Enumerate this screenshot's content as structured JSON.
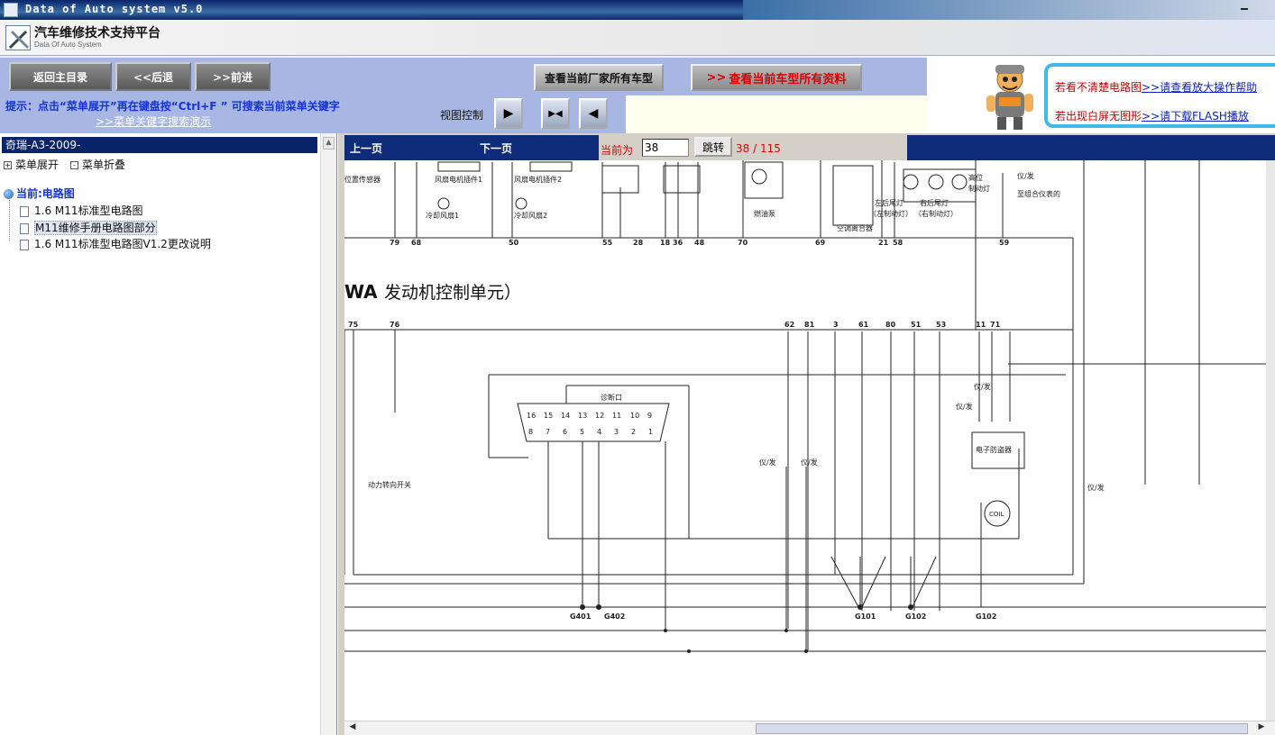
{
  "window": {
    "title": "Data of Auto system v5.0"
  },
  "header": {
    "title": "汽车维修技术支持平台",
    "subtitle": "Data Of Auto System"
  },
  "toolbar": {
    "back_main": "返回主目录",
    "back": "<<后退",
    "forward": ">>前进",
    "view_all_models": "查看当前厂家所有车型",
    "view_all_data": "查看当前车型所有资料"
  },
  "hint": {
    "text": "提示：点击“菜单展开”再在键盘按“Ctrl+F ” 可搜索当前菜单关键字",
    "demo_link": ">>菜单关键字搜索演示",
    "view_control": "视图控制"
  },
  "help": {
    "line1_prefix": "若看不清楚电路图",
    "line1_link": ">>请查看放大操作帮助",
    "line2_prefix": "若出现白屏无图形",
    "line2_link": ">>请下载FLASH播放"
  },
  "sidebar": {
    "car_title": "奇瑞-A3-2009-",
    "expand": "菜单展开",
    "collapse": "菜单折叠",
    "current": "当前:电路图",
    "items": [
      {
        "label": "1.6 M11标准型电路图"
      },
      {
        "label": "M11维修手册电路图部分"
      },
      {
        "label": "1.6 M11标准型电路图V1.2更改说明"
      }
    ]
  },
  "docnav": {
    "prev": "上一页",
    "next": "下一页",
    "current_label": "当前为",
    "page_value": "38",
    "jump": "跳转",
    "page_count": "38 / 115"
  },
  "diagram": {
    "section_title": "发动机控制单元）",
    "section_prefix": "WA",
    "labels": {
      "pos_sensor": "位置传感器",
      "fan_relay1": "风扇电机插件1",
      "fan_relay2": "风扇电机插件2",
      "cool_fan1": "冷却风扇1",
      "cool_fan2": "冷却风扇2",
      "fuel_pump": "燃油泵",
      "ac_clutch": "空调离合器",
      "left_tail": "左后尾灯",
      "left_brake": "（左制动灯）",
      "right_tail": "右后尾灯",
      "right_brake": "（右制动灯）",
      "high_brake": "高位",
      "brake_lamp": "制动灯",
      "to_cluster": "至组合仪表的",
      "diag_port": "诊断口",
      "immobilizer": "电子防盗器",
      "power_steer": "动力转向开关",
      "coil": "COIL",
      "yi_fa_20": "仪/发",
      "yi_fa_12": "仪/发",
      "yi_fa_2": "仪/发",
      "yi_fa_13": "仪/发",
      "yi_fa_28": "仪/发",
      "yi_fa_17": "仪/发"
    },
    "pins_top": [
      "79",
      "68",
      "50",
      "55",
      "28",
      "18",
      "36",
      "48",
      "70",
      "69",
      "21",
      "58",
      "59"
    ],
    "pins_mid": [
      "75",
      "76",
      "62",
      "81",
      "3",
      "61",
      "80",
      "51",
      "53",
      "11",
      "71"
    ],
    "grounds": [
      "G401",
      "G402",
      "G101",
      "G102",
      "G102"
    ],
    "obd_top": [
      "16",
      "15",
      "14",
      "13",
      "12",
      "11",
      "10",
      "9"
    ],
    "obd_bottom": [
      "8",
      "7",
      "6",
      "5",
      "4",
      "3",
      "2",
      "1"
    ]
  }
}
